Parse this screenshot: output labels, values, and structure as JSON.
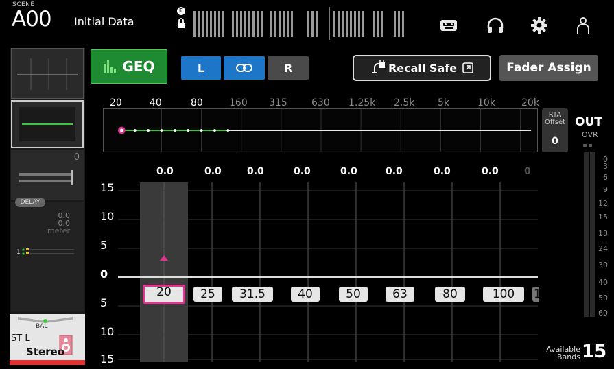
{
  "topbar": {
    "scene_label": "SCENE",
    "scene_number": "A00",
    "scene_title": "Initial Data",
    "e_badge": "E",
    "icons": [
      "tape-icon",
      "headphones-icon",
      "gear-icon",
      "user-icon"
    ]
  },
  "left_strip": {
    "fader_value": "0",
    "delay_label": "DELAY",
    "delay_values": [
      "0.0",
      "0.0"
    ],
    "delay_unit": "meter",
    "bal_label": "BAL",
    "channel_name": "ST L",
    "channel_type": "Stereo"
  },
  "header": {
    "geq_label": "GEQ",
    "left_label": "L",
    "link_icon": "link-icon",
    "right_label": "R",
    "recall_safe_label": "Recall Safe",
    "fader_assign_label": "Fader Assign"
  },
  "freq_scale": [
    "20",
    "40",
    "80",
    "160",
    "315",
    "630",
    "1.25k",
    "2.5k",
    "5k",
    "10k",
    "20k"
  ],
  "rta": {
    "label_line1": "RTA",
    "label_line2": "Offset",
    "value": "0"
  },
  "gain_values": [
    "0.0",
    "0.0",
    "0.0",
    "0.0",
    "0.0",
    "0.0",
    "0.0",
    "0.0",
    "0"
  ],
  "y_axis": [
    "15",
    "10",
    "5",
    "0",
    "5",
    "10",
    "15"
  ],
  "bands": [
    "20",
    "25",
    "31.5",
    "40",
    "50",
    "63",
    "80",
    "100",
    "1"
  ],
  "selected_band": "20",
  "out_meter": {
    "label": "OUT",
    "ovr_label": "OVR",
    "ticks": [
      "0",
      "3",
      "6",
      "9",
      "12",
      "15",
      "18",
      "24",
      "30",
      "40",
      "50",
      "60"
    ]
  },
  "available": {
    "label_line1": "Available",
    "label_line2": "Bands",
    "count": "15"
  },
  "colors": {
    "geq_green": "#1e8a32",
    "link_blue": "#1e76c8",
    "selection_pink": "#e2348f",
    "curve_green": "#3ec83e",
    "stereo_red": "#e03030"
  }
}
